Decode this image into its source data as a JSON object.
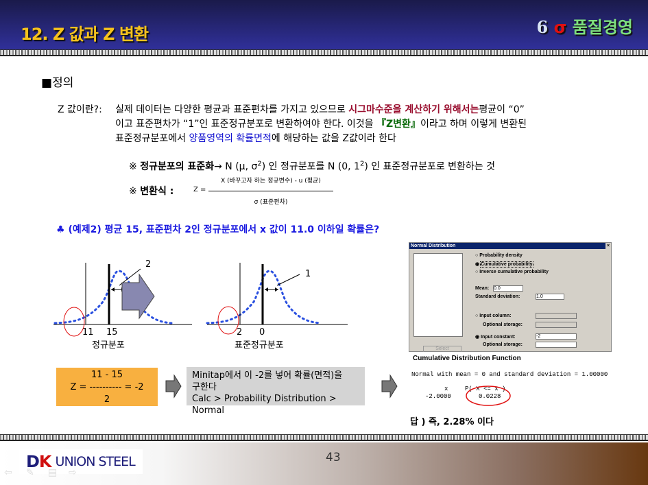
{
  "header": {
    "title": "12. Z 값과 Z 변환",
    "brand_six": "6",
    "brand_sigma": "σ",
    "brand_text": "품질경영"
  },
  "section": {
    "bullet": "■",
    "title": "정의"
  },
  "definition": {
    "label": "Z 값이란?:",
    "line1_a": "실제 데이터는 다양한 평균과 표준편차를 가지고 있으므로 ",
    "line1_red": "시그마수준을 계산하기 위해서는",
    "line1_b": "평균이 “0”",
    "line2_a": "이고 표준편차가 “1”인  표준정규분포로 변환하여야 한다. 이것을  ",
    "line2_green": "『Z변환』",
    "line2_b": "이라고 하며 이렇게 변환된",
    "line3_a": "표준정규분포에서 ",
    "line3_blue": "양품영역의 확률면적",
    "line3_b": "에 해당하는 값을 Z값이라 한다"
  },
  "note1": {
    "mark": "※",
    "bold": "정규분포의 표준화",
    "text_a": "→ N (μ, σ",
    "sup1": "2",
    "text_b": ") 인 정규분포를 N (0,  1",
    "sup2": "2",
    "text_c": ") 인 표준정규분포로 변환하는 것"
  },
  "note2": {
    "mark": "※",
    "bold": "변환식 :",
    "z": "Z =",
    "numerator": "X (바꾸고자 하는 정규변수) - u (평균)",
    "denominator": "σ (표준편차)"
  },
  "example": {
    "icon": "♣",
    "text": "(예제2) 평균 15, 표준편차 2인 정규분포에서 x 값이 11.0 이하일 확률은?"
  },
  "diagram_left": {
    "sd_label": "2",
    "x1": "11",
    "x2": "15",
    "caption": "정규분포"
  },
  "diagram_right": {
    "sd_label": "1",
    "x1": "2",
    "x2": "0",
    "caption": "표준정규분포"
  },
  "zcalc": {
    "numerator": "11 - 15",
    "middle": "Z = ---------- = -2",
    "denominator": "2"
  },
  "instruction": {
    "line1": "Minitap에서 이 -2를 넣어 확률(면적)을",
    "line2": "구한다",
    "line3": "Calc > Probability Distribution > Normal"
  },
  "dialog": {
    "title": "Normal Distribution",
    "close": "×",
    "options": [
      "Probability density",
      "Cumulative probability",
      "Inverse cumulative probability"
    ],
    "mean_label": "Mean:",
    "mean_value": "0.0",
    "sd_label": "Standard deviation:",
    "sd_value": "1.0",
    "input_column": "Input column:",
    "optional_storage": "Optional storage:",
    "input_constant": "Input constant:",
    "constant_value": "-2",
    "optional_storage2": "Optional storage:",
    "select": "Select"
  },
  "output": {
    "title": "Cumulative Distribution Function",
    "desc": "Normal with mean = 0 and standard deviation = 1.00000",
    "col_x": "x",
    "col_p": "P( X <= x )",
    "val_x": "-2.0000",
    "val_p": "0.0228"
  },
  "answer": "답 ) 즉, 2.28% 이다",
  "footer": {
    "logo": "DK UNION STEEL",
    "logo_text": "UNION STEEL",
    "page": "43",
    "nav_prev": "⇦",
    "nav_pen": "✎",
    "nav_menu": "▤",
    "nav_next": "⇨"
  }
}
